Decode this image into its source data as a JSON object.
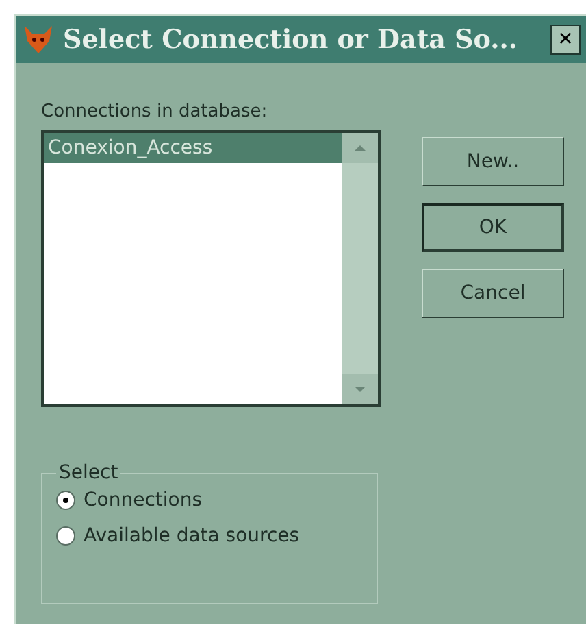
{
  "window": {
    "title": "Select Connection or Data So...",
    "close": "✕"
  },
  "list": {
    "label": "Connections in database:",
    "items": [
      {
        "text": "Conexion_Access",
        "selected": true
      }
    ]
  },
  "buttons": [
    {
      "label": "New..",
      "default": false
    },
    {
      "label": "OK",
      "default": true
    },
    {
      "label": "Cancel",
      "default": false
    }
  ],
  "group": {
    "title": "Select",
    "options": [
      {
        "label": "Connections",
        "selected": true
      },
      {
        "label": "Available data sources",
        "selected": false
      }
    ]
  }
}
